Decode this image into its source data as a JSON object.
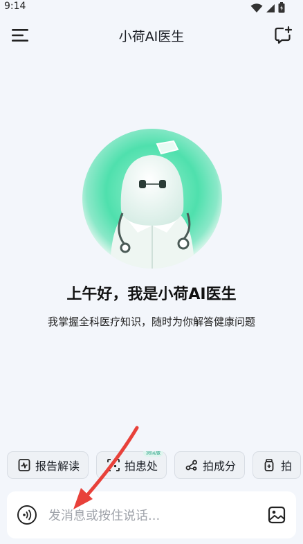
{
  "status_bar": {
    "time": "9:14"
  },
  "header": {
    "title": "小荷AI医生"
  },
  "greeting": {
    "title": "上午好，我是小荷AI医生",
    "subtitle": "我掌握全科医疗知识，随时为你解答健康问题"
  },
  "quick_actions": [
    {
      "label": "报告解读",
      "icon": "report-chart-icon"
    },
    {
      "label": "拍患处",
      "icon": "camera-scan-icon",
      "badge": "测试版"
    },
    {
      "label": "拍成分",
      "icon": "ingredients-icon"
    },
    {
      "label": "拍",
      "icon": "medicine-bottle-icon"
    }
  ],
  "input": {
    "placeholder": "发消息或按住说话..."
  },
  "colors": {
    "accent_mint": "#45dca8",
    "annotation_red": "#e8413a"
  }
}
